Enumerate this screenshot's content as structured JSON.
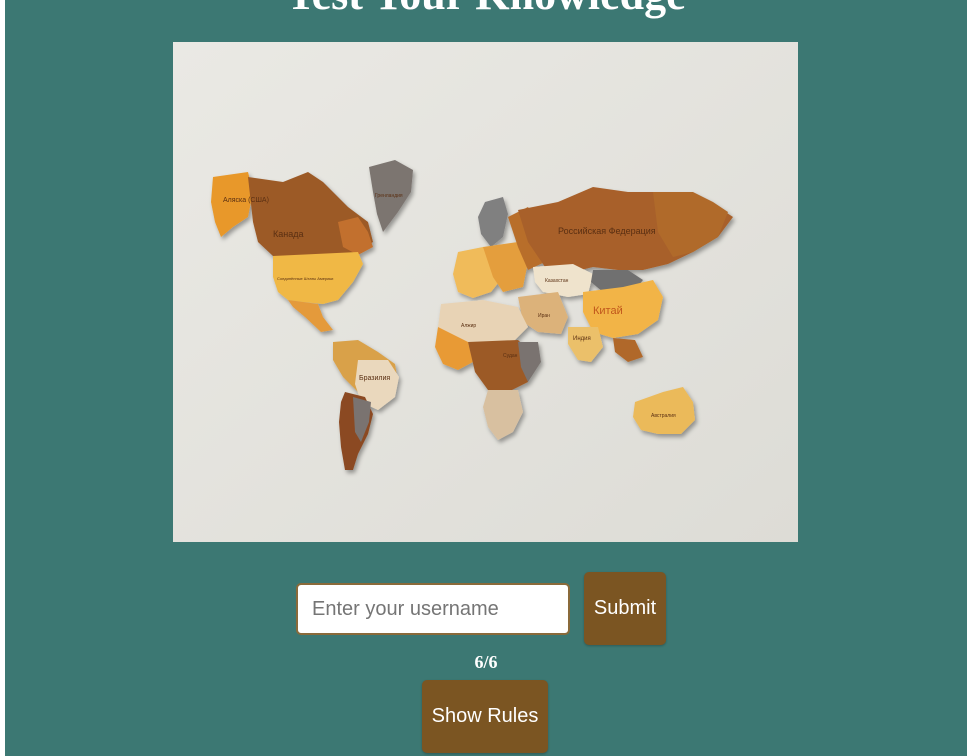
{
  "header": {
    "title": "Test Your Knowledge"
  },
  "map_image": {
    "labels": {
      "alaska": "Аляска (США)",
      "canada": "Канада",
      "greenland": "Гренландия",
      "usa": "Соединённые Штаты Америки",
      "brazil": "Бразилия",
      "russia": "Российская Федерация",
      "kazakhstan": "Казахстан",
      "china": "Китай",
      "india": "Индия",
      "iran": "Иран",
      "algeria": "Алжир",
      "sudan": "Судан",
      "australia": "Австралия"
    }
  },
  "form": {
    "username_placeholder": "Enter your username",
    "username_value": "",
    "submit_label": "Submit"
  },
  "progress": {
    "text": "6/6"
  },
  "rules": {
    "button_label": "Show Rules"
  },
  "colors": {
    "page_background": "#3c7873",
    "button_background": "#7b5522",
    "input_border": "#8a6a3a"
  }
}
